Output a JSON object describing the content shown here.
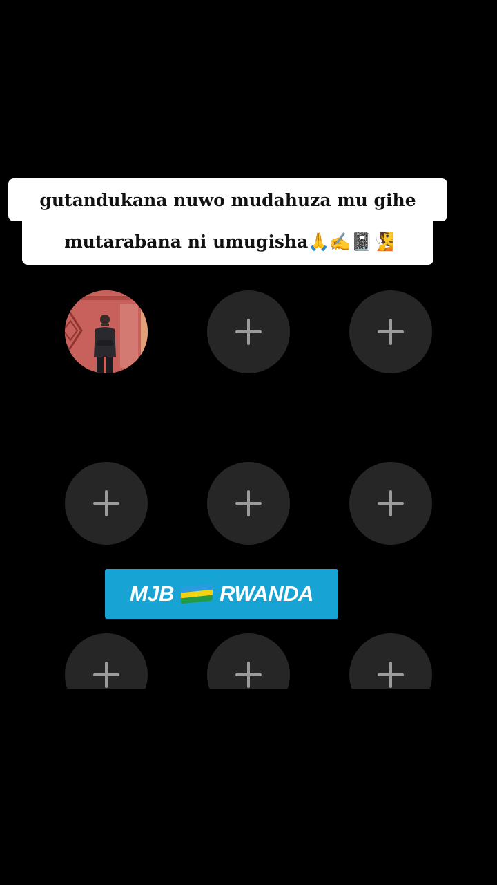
{
  "caption": {
    "line1": "gutandukana nuwo mudahuza mu gihe",
    "line2": "mutarabana ni umugisha🙏✍️📓🧏"
  },
  "grid": {
    "add_symbol_label": "+",
    "avatar_icon": "person-photo",
    "add_icon": "plus-icon"
  },
  "banner": {
    "left_text": "MJB",
    "flag_icon": "rwanda-flag",
    "right_text": "RWANDA",
    "background": "#17a4d4"
  },
  "colors": {
    "page_background": "#000000",
    "slot_background": "#262626",
    "plus_color": "#9b9b9b"
  }
}
